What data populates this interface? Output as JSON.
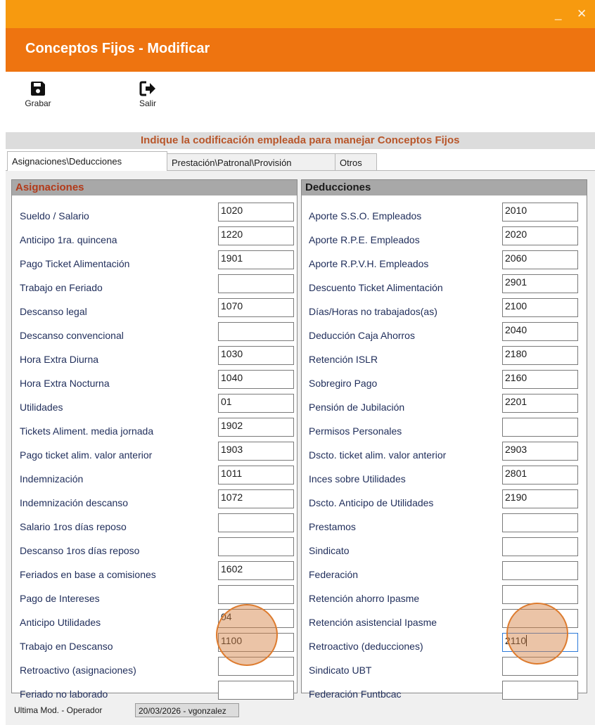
{
  "window": {
    "title": "Conceptos Fijos - Modificar",
    "minimize_glyph": "_",
    "close_glyph": "✕"
  },
  "toolbar": {
    "save_label": "Grabar",
    "save_icon": "floppy-disk-icon",
    "exit_label": "Salir",
    "exit_icon": "sign-out-icon"
  },
  "banner": "Indique la codificación empleada para manejar Conceptos Fijos",
  "tabs": [
    {
      "label": "Asignaciones\\Deducciones",
      "active": true
    },
    {
      "label": "Prestación\\Patronal\\Provisión",
      "active": false
    },
    {
      "label": "Otros",
      "active": false
    }
  ],
  "asignaciones": {
    "title": "Asignaciones",
    "rows": [
      {
        "label": "Sueldo / Salario",
        "value": "1020"
      },
      {
        "label": "Anticipo 1ra. quincena",
        "value": "1220"
      },
      {
        "label": "Pago Ticket Alimentación",
        "value": "1901"
      },
      {
        "label": "Trabajo en Feriado",
        "value": ""
      },
      {
        "label": "Descanso legal",
        "value": "1070"
      },
      {
        "label": "Descanso convencional",
        "value": ""
      },
      {
        "label": "Hora Extra Diurna",
        "value": "1030"
      },
      {
        "label": "Hora Extra Nocturna",
        "value": "1040"
      },
      {
        "label": "Utilidades",
        "value": "01"
      },
      {
        "label": "Tickets Aliment. media jornada",
        "value": "1902"
      },
      {
        "label": "Pago ticket alim. valor anterior",
        "value": "1903"
      },
      {
        "label": "Indemnización",
        "value": "1011"
      },
      {
        "label": "Indemnización descanso",
        "value": "1072"
      },
      {
        "label": "Salario 1ros días reposo",
        "value": ""
      },
      {
        "label": "Descanso 1ros días reposo",
        "value": ""
      },
      {
        "label": "Feriados en base a comisiones",
        "value": "1602"
      },
      {
        "label": "Pago de Intereses",
        "value": ""
      },
      {
        "label": "Anticipo Utilidades",
        "value": "04"
      },
      {
        "label": "Trabajo en Descanso",
        "value": "1100"
      },
      {
        "label": "Retroactivo (asignaciones)",
        "value": ""
      },
      {
        "label": "Feriado no laborado",
        "value": ""
      }
    ]
  },
  "deducciones": {
    "title": "Deducciones",
    "rows": [
      {
        "label": "Aporte S.S.O. Empleados",
        "value": "2010"
      },
      {
        "label": "Aporte R.P.E.  Empleados",
        "value": "2020"
      },
      {
        "label": "Aporte R.P.V.H. Empleados",
        "value": "2060"
      },
      {
        "label": "Descuento Ticket Alimentación",
        "value": "2901"
      },
      {
        "label": "Días/Horas no trabajados(as)",
        "value": "2100"
      },
      {
        "label": "Deducción Caja Ahorros",
        "value": "2040"
      },
      {
        "label": "Retención ISLR",
        "value": "2180"
      },
      {
        "label": "Sobregiro Pago",
        "value": "2160"
      },
      {
        "label": "Pensión de Jubilación",
        "value": "2201"
      },
      {
        "label": "Permisos Personales",
        "value": ""
      },
      {
        "label": "Dscto. ticket alim. valor anterior",
        "value": "2903"
      },
      {
        "label": "Inces sobre Utilidades",
        "value": "2801"
      },
      {
        "label": "Dscto. Anticipo de Utilidades",
        "value": "2190"
      },
      {
        "label": "Prestamos",
        "value": ""
      },
      {
        "label": "Sindicato",
        "value": ""
      },
      {
        "label": "Federación",
        "value": ""
      },
      {
        "label": "Retención ahorro Ipasme",
        "value": ""
      },
      {
        "label": "Retención asistencial Ipasme",
        "value": ""
      },
      {
        "label": "Retroactivo (deducciones)",
        "value": "2110"
      },
      {
        "label": "Sindicato UBT",
        "value": ""
      },
      {
        "label": "Federación Funtbcac",
        "value": ""
      }
    ]
  },
  "status": {
    "label": "Ultima Mod. - Operador",
    "value": "20/03/2026 - vgonzalez"
  }
}
